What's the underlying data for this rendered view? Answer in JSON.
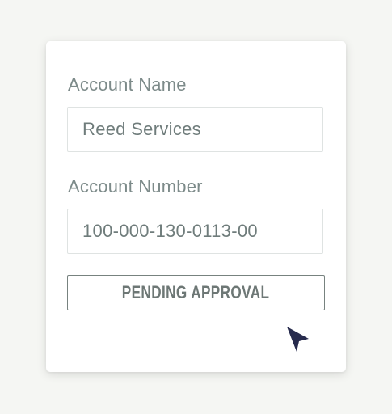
{
  "form": {
    "account_name_label": "Account Name",
    "account_name_value": "Reed Services",
    "account_number_label": "Account Number",
    "account_number_value": "100-000-130-0113-00",
    "status_label": "PENDING APPROVAL"
  },
  "icons": {
    "cursor": "mouse-pointer-icon"
  },
  "colors": {
    "label_text": "#7d8b8a",
    "field_text": "#6f7c7b",
    "status_border": "#77827f",
    "cursor": "#272b4d"
  }
}
